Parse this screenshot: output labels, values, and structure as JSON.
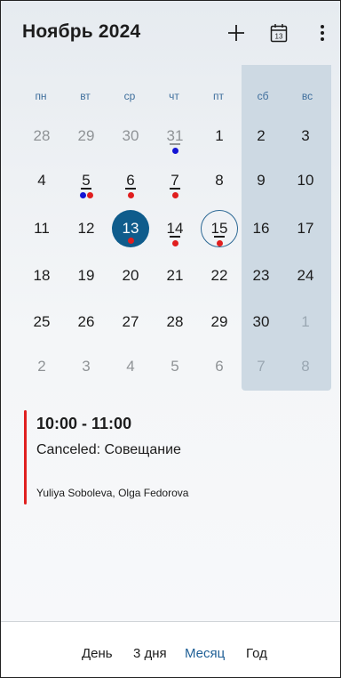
{
  "header": {
    "title": "Ноябрь 2024",
    "add_icon": "plus-icon",
    "today_icon": "calendar-today-icon",
    "today_icon_number": "13",
    "more_icon": "more-vertical-icon"
  },
  "weekdays": [
    "пн",
    "вт",
    "ср",
    "чт",
    "пт",
    "сб",
    "вс"
  ],
  "weeks": [
    [
      "28",
      "29",
      "30",
      "31",
      "1",
      "2",
      "3"
    ],
    [
      "4",
      "5",
      "6",
      "7",
      "8",
      "9",
      "10"
    ],
    [
      "11",
      "12",
      "13",
      "14",
      "15",
      "16",
      "17"
    ],
    [
      "18",
      "19",
      "20",
      "21",
      "22",
      "23",
      "24"
    ],
    [
      "25",
      "26",
      "27",
      "28",
      "29",
      "30",
      "1"
    ],
    [
      "2",
      "3",
      "4",
      "5",
      "6",
      "7",
      "8"
    ]
  ],
  "event": {
    "time": "10:00 - 11:00",
    "title": "Canceled: Совещание",
    "attendees": "Yuliya Soboleva, Olga Fedorova",
    "color": "#e02020"
  },
  "tabs": [
    "День",
    "3 дня",
    "Месяц",
    "Год"
  ],
  "colors": {
    "selected_day": "#0f5c8c",
    "accent": "#1f5f96",
    "event_dot_red": "#e01e1e",
    "event_dot_blue": "#1414d4",
    "weekend_column": "#cdd9e3"
  }
}
